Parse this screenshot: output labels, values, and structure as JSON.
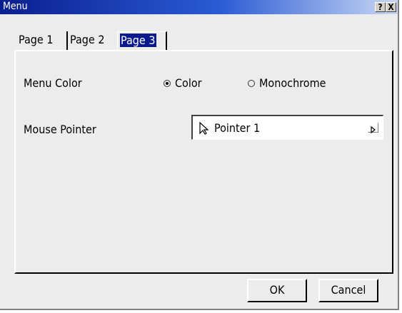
{
  "window": {
    "title": "Menu",
    "help_label": "?",
    "close_label": "X"
  },
  "tabs": [
    {
      "label": "Page 1",
      "active": false
    },
    {
      "label": "Page 2",
      "active": false
    },
    {
      "label": "Page 3",
      "active": true
    }
  ],
  "menu_color": {
    "label": "Menu Color",
    "options": [
      {
        "label": "Color",
        "selected": true
      },
      {
        "label": "Monochrome",
        "selected": false
      }
    ]
  },
  "mouse_pointer": {
    "label": "Mouse Pointer",
    "value": "Pointer 1"
  },
  "buttons": {
    "ok": "OK",
    "cancel": "Cancel"
  },
  "colors": {
    "title_start": "#0a1f8f",
    "title_end": "#c9d7f4",
    "active_tab": "#0a1a8c",
    "face": "#ececec"
  }
}
